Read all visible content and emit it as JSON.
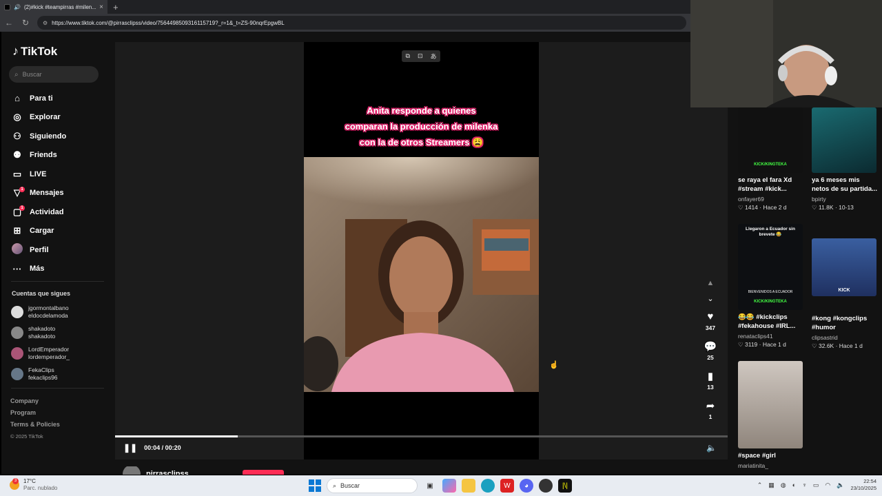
{
  "browser": {
    "tab_title": "(2)#kick #teampirras #milen...",
    "tab_close": "×",
    "new_tab": "+",
    "url": "https://www.tiktok.com/@pirrasclipss/video/7564498509316115719?_r=1&_t=ZS-90nqrEpgwBL"
  },
  "sidebar": {
    "logo": "TikTok",
    "search_placeholder": "Buscar",
    "nav": [
      {
        "label": "Para ti",
        "icon": "home-icon"
      },
      {
        "label": "Explorar",
        "icon": "compass-icon"
      },
      {
        "label": "Siguiendo",
        "icon": "following-icon"
      },
      {
        "label": "Friends",
        "icon": "friends-icon"
      },
      {
        "label": "LIVE",
        "icon": "live-icon"
      },
      {
        "label": "Mensajes",
        "icon": "messages-icon",
        "badge": "1"
      },
      {
        "label": "Actividad",
        "icon": "activity-icon",
        "badge": "1"
      },
      {
        "label": "Cargar",
        "icon": "upload-icon"
      },
      {
        "label": "Perfil",
        "icon": "profile-avatar"
      },
      {
        "label": "Más",
        "icon": "more-icon"
      }
    ],
    "following_title": "Cuentas que sigues",
    "following": [
      {
        "name": "jgormontalbano",
        "handle": "eldocdelamoda"
      },
      {
        "name": "shakadoto",
        "handle": "shakadoto"
      },
      {
        "name": "LordEmperador",
        "handle": "lordemperador_"
      },
      {
        "name": "FekaClips",
        "handle": "fekaclips96"
      }
    ],
    "footer": {
      "company": "Company",
      "program": "Program",
      "terms": "Terms & Policies",
      "copyright": "© 2025 TikTok"
    }
  },
  "video": {
    "caption_line1": "Anita responde a quienes",
    "caption_line2": "comparan la producción de milenka",
    "caption_line3": "con la de otros Streamers 😩",
    "time": "00:04 / 00:20",
    "progress": 0.2
  },
  "actions": {
    "likes": "347",
    "comments": "25",
    "saves": "13",
    "shares": "1"
  },
  "feed": [
    {
      "title": "se raya el fara Xd #stream #kick...",
      "user": "onfayer69",
      "likes": "1414",
      "date": "Hace 2 d",
      "thumb_text": "KICK/KINGTEKA"
    },
    {
      "title": "ya 6 meses mis netos de su partida...",
      "user": "bpirty",
      "likes": "11.8K",
      "date": "10-13",
      "thumb_text": ""
    },
    {
      "title": "😂😂 #kickclips #fekahouse #IRL...",
      "user": "renataclips41",
      "likes": "3119",
      "date": "Hace 1 d",
      "thumb_text": "Llegaron a Ecuador sin brevete 😂",
      "thumb_text2": "BIENVENIDOS A ECUADOR",
      "thumb_text3": "KICK/KINGTEKA"
    },
    {
      "title": "#kong #kongclips #humor",
      "user": "clipsastrid",
      "likes": "32.6K",
      "date": "Hace 1 d",
      "thumb_text": "KICK"
    },
    {
      "title": "#space #girl",
      "user": "mariatinita_",
      "likes": "",
      "date": "",
      "thumb_text": ""
    }
  ],
  "author": {
    "name": "pirrasclipss"
  },
  "taskbar": {
    "temp": "17°C",
    "weather": "Parc. nublado",
    "search": "Buscar",
    "time": "22:54",
    "date": "23/10/2025",
    "weather_badge": "3"
  }
}
